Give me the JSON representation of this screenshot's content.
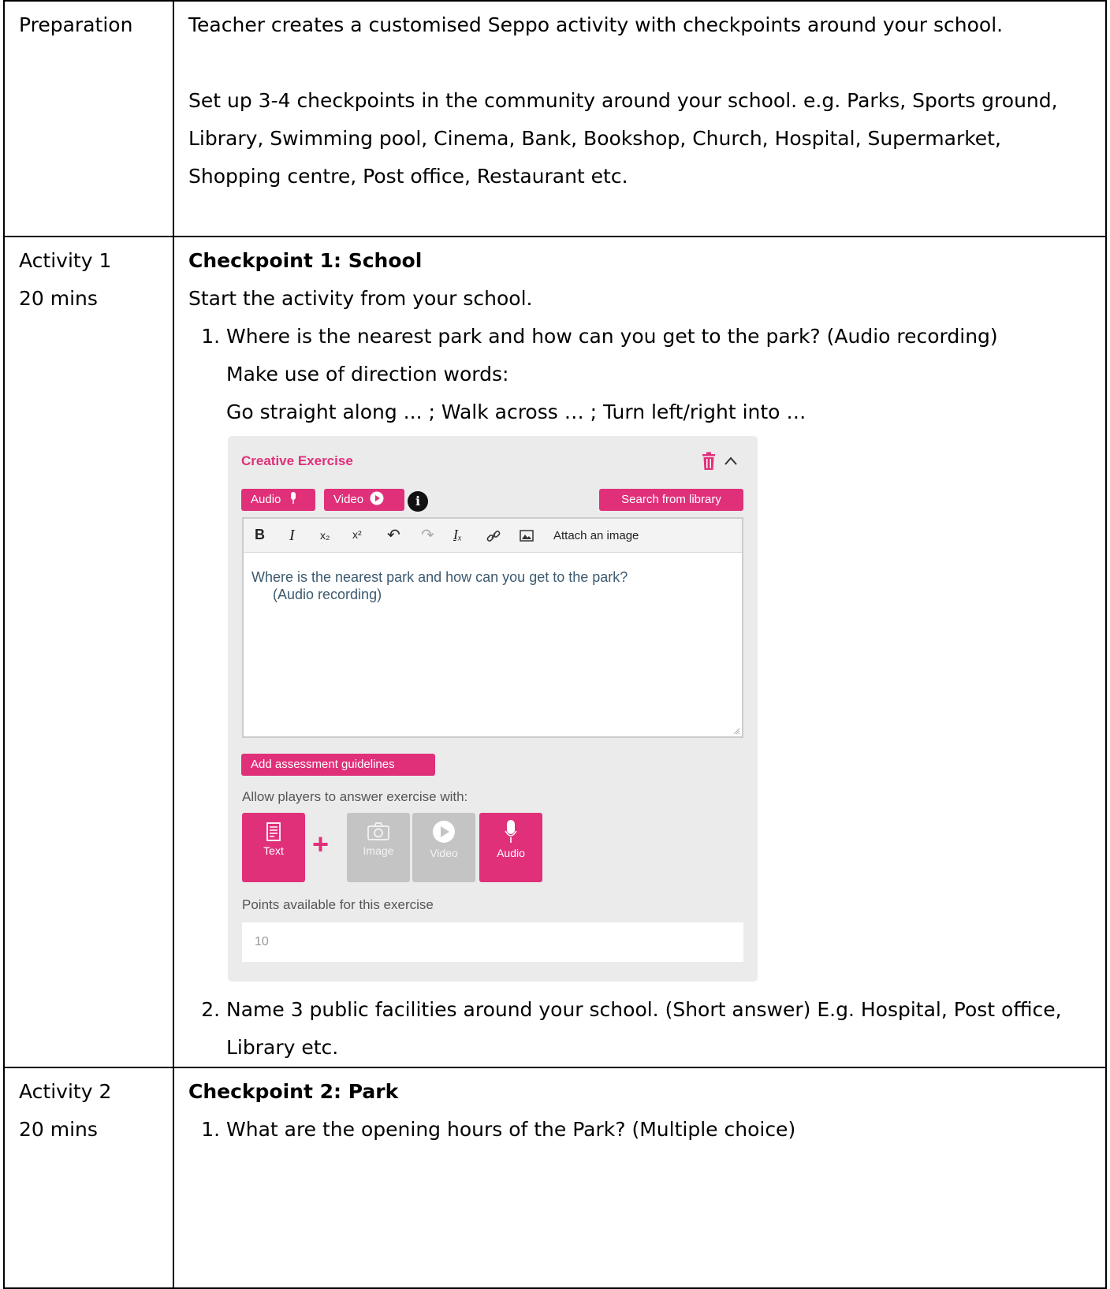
{
  "rows": {
    "preparation": {
      "label": "Preparation",
      "para1": "Teacher creates a customised Seppo activity with checkpoints around your school.",
      "para2_lines": [
        "Set up 3-4 checkpoints in the community around your school. e.g. Parks, Sports ground,",
        "Library, Swimming pool, Cinema, Bank, Bookshop, Church, Hospital, Supermarket,",
        "Shopping centre, Post office, Restaurant etc."
      ]
    },
    "activity1": {
      "label": "Activity 1",
      "duration": "20 mins",
      "heading": "Checkpoint 1: School",
      "intro": "Start the activity from your school.",
      "item1": {
        "line1": "Where is the nearest park and how can you get to the park? (Audio recording)",
        "line2": "Make use of direction words:",
        "line3": "Go straight along ... ; Walk across … ; Turn left/right into …"
      },
      "item2": {
        "line1": "Name 3 public facilities around your school. (Short answer) E.g. Hospital, Post office,",
        "line2": "Library etc."
      }
    },
    "activity2": {
      "label": "Activity 2",
      "duration": "20 mins",
      "heading": "Checkpoint 2: Park",
      "item1": "What are the opening hours of the Park? (Multiple choice)"
    }
  },
  "panel": {
    "title": "Creative Exercise",
    "audio_btn": "Audio",
    "video_btn": "Video",
    "info": "i",
    "search_btn": "Search from library",
    "toolbar": {
      "bold": "B",
      "italic": "I",
      "subscript": "x₂",
      "superscript": "x²",
      "undo": "↶",
      "redo": "↷",
      "clear": "Iₓ",
      "link": "🔗",
      "attach": "Attach an image"
    },
    "editor_line1": "Where is the nearest park and how can you get to the park?",
    "editor_line2": "(Audio recording)",
    "assess_btn": "Add assessment guidelines",
    "allow_label": "Allow players to answer exercise with:",
    "answer_types": {
      "text": "Text",
      "plus": "+",
      "image": "Image",
      "video": "Video",
      "audio": "Audio"
    },
    "points_label": "Points available for this exercise",
    "points_value": "10",
    "accent_color": "#e0307a"
  }
}
